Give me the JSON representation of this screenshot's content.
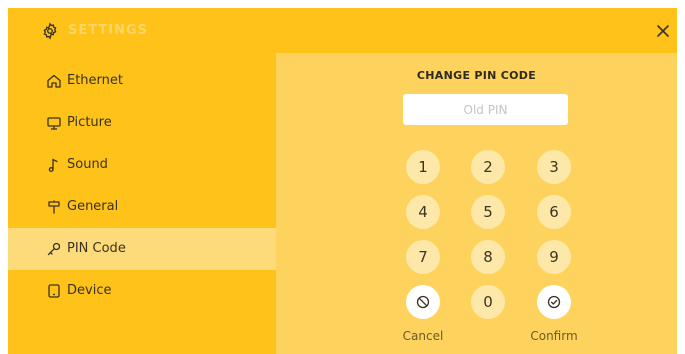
{
  "header": {
    "title": "SETTINGS",
    "gear_icon": "gear-icon",
    "close_icon": "close-icon"
  },
  "sidebar": {
    "items": [
      {
        "label": "Ethernet",
        "icon": "home-icon",
        "active": false
      },
      {
        "label": "Picture",
        "icon": "monitor-icon",
        "active": false
      },
      {
        "label": "Sound",
        "icon": "music-note-icon",
        "active": false
      },
      {
        "label": "General",
        "icon": "signpost-icon",
        "active": false
      },
      {
        "label": "PIN Code",
        "icon": "key-icon",
        "active": true
      },
      {
        "label": "Device",
        "icon": "tablet-icon",
        "active": false
      }
    ]
  },
  "main": {
    "heading": "CHANGE PIN CODE",
    "pin_input": {
      "value": "",
      "placeholder": "Old PIN"
    },
    "keypad": {
      "keys": [
        "1",
        "2",
        "3",
        "4",
        "5",
        "6",
        "7",
        "8",
        "9",
        "0"
      ],
      "cancel_label": "Cancel",
      "confirm_label": "Confirm",
      "cancel_icon": "cancel-circle-icon",
      "confirm_icon": "check-circle-icon"
    }
  },
  "colors": {
    "header_bg": "#fec219",
    "sidebar_bg": "#fec219",
    "main_bg": "#fdd35d",
    "active_item_bg": "#fedb7a",
    "key_bg": "#fee8a9",
    "action_key_bg": "#ffffff"
  }
}
